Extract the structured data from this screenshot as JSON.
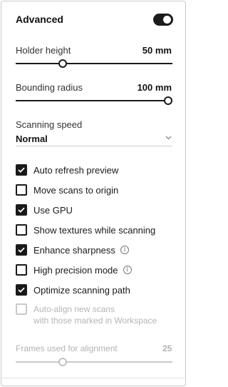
{
  "header": {
    "title": "Advanced",
    "toggle_on": true
  },
  "holder_height": {
    "label": "Holder height",
    "value": "50 mm",
    "level": 0.3
  },
  "bounding_radius": {
    "label": "Bounding radius",
    "value": "100 mm",
    "level": 1.0
  },
  "scanning_speed": {
    "label": "Scanning speed",
    "value": "Normal"
  },
  "options": [
    {
      "label": "Auto refresh preview",
      "checked": true,
      "info": false
    },
    {
      "label": "Move scans to origin",
      "checked": false,
      "info": false
    },
    {
      "label": "Use GPU",
      "checked": true,
      "info": false
    },
    {
      "label": "Show textures while scanning",
      "checked": false,
      "info": false
    },
    {
      "label": "Enhance sharpness",
      "checked": true,
      "info": true
    },
    {
      "label": "High precision mode",
      "checked": false,
      "info": true
    },
    {
      "label": "Optimize scanning path",
      "checked": true,
      "info": false
    }
  ],
  "auto_align": {
    "line1": "Auto-align new scans",
    "line2": "with those marked in Workspace",
    "checked": false,
    "disabled": true
  },
  "frames": {
    "label": "Frames used for alignment",
    "value": "25",
    "level": 0.3
  },
  "icons": {
    "info": "info-icon",
    "chevron": "chevron-down-icon",
    "check": "checkmark-icon"
  }
}
